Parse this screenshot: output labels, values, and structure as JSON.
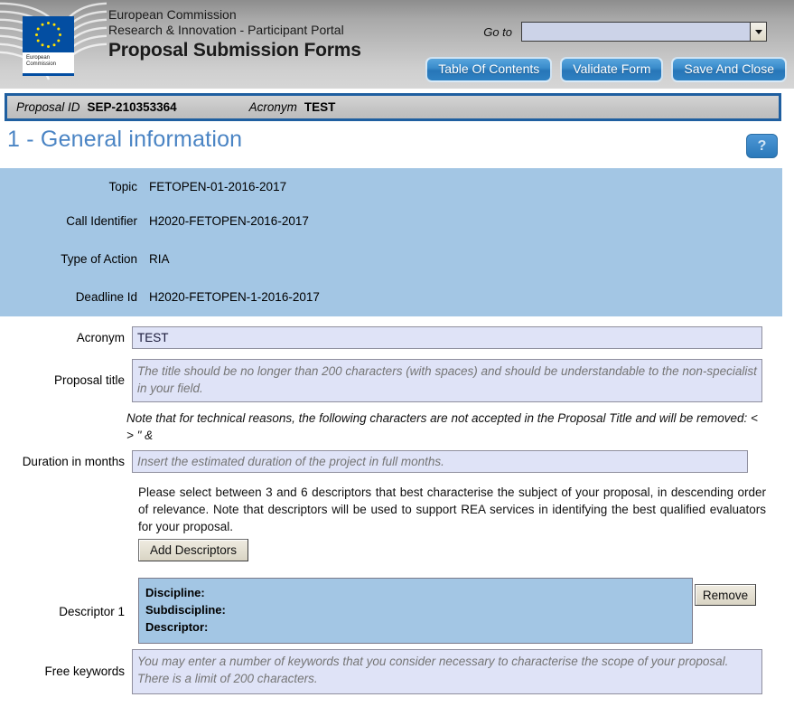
{
  "header": {
    "logo_caption_line1": "European",
    "logo_caption_line2": "Commission",
    "title_line1": "European Commission",
    "title_line2": "Research & Innovation - Participant Portal",
    "title_line3": "Proposal Submission Forms",
    "goto_label": "Go to",
    "goto_value": "",
    "buttons": [
      {
        "label": "Table Of Contents",
        "name": "table-of-contents-button"
      },
      {
        "label": "Validate Form",
        "name": "validate-form-button"
      },
      {
        "label": "Save And Close",
        "name": "save-and-close-button"
      }
    ]
  },
  "idbar": {
    "proposal_id_label": "Proposal ID",
    "proposal_id_value": "SEP-210353364",
    "acronym_label": "Acronym",
    "acronym_value": "TEST"
  },
  "page": {
    "title": "1 - General information",
    "help_label": "?"
  },
  "info_panel": [
    {
      "label": "Topic",
      "value": "FETOPEN-01-2016-2017"
    },
    {
      "label": "Call Identifier",
      "value": "H2020-FETOPEN-2016-2017"
    },
    {
      "label": "Type of Action",
      "value": "RIA"
    },
    {
      "label": "Deadline Id",
      "value": "H2020-FETOPEN-1-2016-2017"
    }
  ],
  "form": {
    "acronym_label": "Acronym",
    "acronym_value": "TEST",
    "proposal_title_label": "Proposal title",
    "proposal_title_placeholder": "The title should be no longer than 200 characters (with spaces) and should be understandable to the non-specialist in your field.",
    "title_note": "Note that for technical reasons, the following characters are not accepted in the Proposal Title and will be removed: < > \" &",
    "duration_label": "Duration in months",
    "duration_placeholder": "Insert the estimated duration of the project in full months.",
    "descriptors_paragraph": "Please select between 3 and 6 descriptors that best characterise the subject of your proposal, in descending order of relevance. Note that descriptors will be used to support REA services in identifying the best qualified evaluators for your proposal.",
    "add_descriptors_label": "Add Descriptors",
    "descriptor_label": "Descriptor 1",
    "descriptor_discipline": "Discipline:",
    "descriptor_subdiscipline": "Subdiscipline:",
    "descriptor_descriptor": "Descriptor:",
    "remove_label": "Remove",
    "free_keywords_label": "Free keywords",
    "free_keywords_placeholder": "You may enter a number of keywords that you consider necessary to characterise the scope of your proposal. There is a limit of 200 characters."
  },
  "colors": {
    "accent_blue": "#2776b8",
    "panel_blue": "#a3c6e4",
    "title_blue": "#4a84c4",
    "field_blue": "#dfe3f7",
    "border_blue": "#1f5fa0"
  }
}
